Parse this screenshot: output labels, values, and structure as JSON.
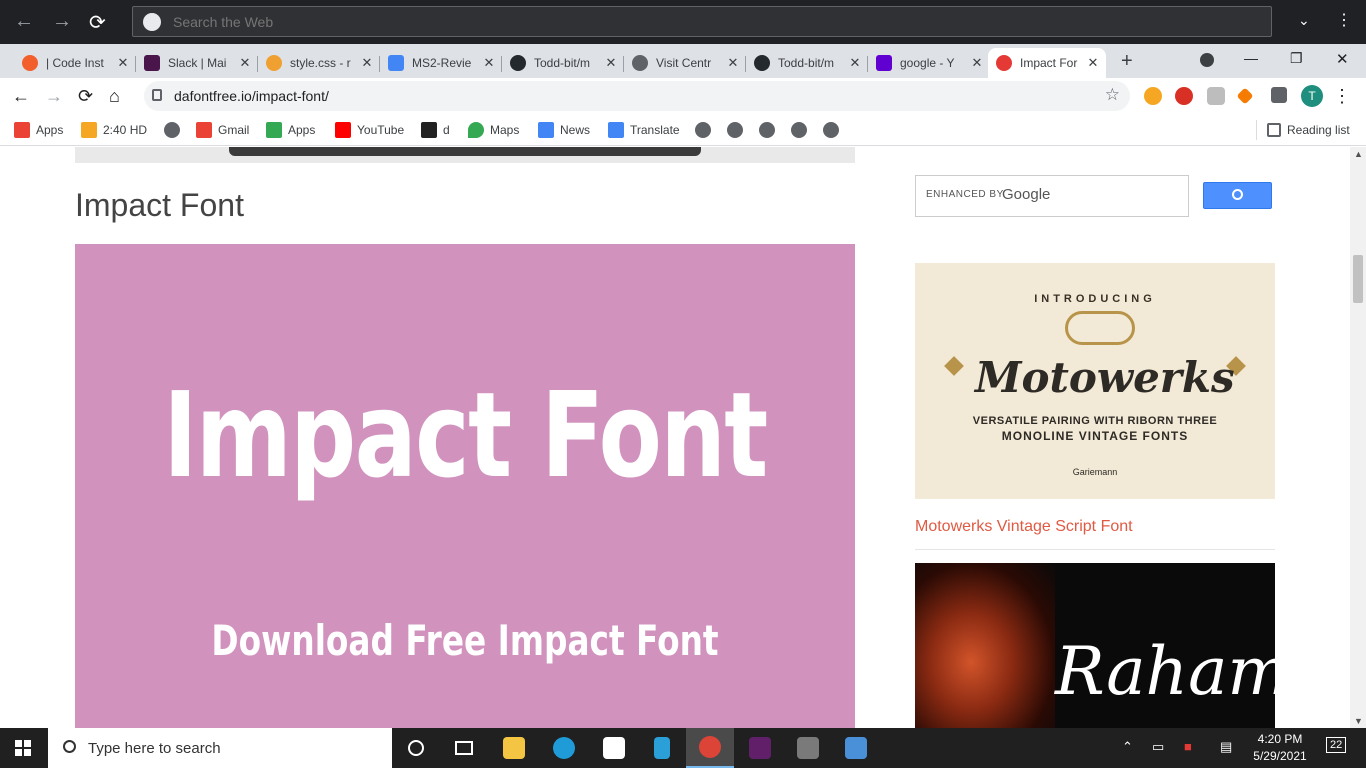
{
  "top_search": {
    "placeholder": "Search the Web"
  },
  "tabs": [
    {
      "label": "| Code Inst",
      "color": "#f25f2c"
    },
    {
      "label": "Slack | Mai",
      "color": "#4a154b"
    },
    {
      "label": "style.css - r",
      "color": "#f0a030"
    },
    {
      "label": "MS2-Revie",
      "color": "#4285f4"
    },
    {
      "label": "Todd-bit/m",
      "color": "#24292e"
    },
    {
      "label": "Visit Centr",
      "color": "#5f6368"
    },
    {
      "label": "Todd-bit/m",
      "color": "#24292e"
    },
    {
      "label": "google - Y",
      "color": "#6001d2"
    },
    {
      "label": "Impact For",
      "color": "#e53935"
    }
  ],
  "new_tab": "+",
  "window_controls": {
    "minimize": "—",
    "restore": "❐",
    "close": "✕"
  },
  "omnibox": {
    "url": "dafontfree.io/impact-font/"
  },
  "profile_initial": "T",
  "bookmarks": [
    {
      "label": "Apps",
      "color": "#ea4335"
    },
    {
      "label": "2:40 HD",
      "color": "#f5a623"
    },
    {
      "label": "",
      "color": "#5f6368"
    },
    {
      "label": "Gmail",
      "color": "#ea4335"
    },
    {
      "label": "Apps",
      "color": "#34a853"
    },
    {
      "label": "YouTube",
      "color": "#ff0000"
    },
    {
      "label": "d",
      "color": "#222222"
    },
    {
      "label": "Maps",
      "color": "#34a853"
    },
    {
      "label": "News",
      "color": "#4285f4"
    },
    {
      "label": "Translate",
      "color": "#4285f4"
    },
    {
      "label": "",
      "color": "#5f6368"
    },
    {
      "label": "",
      "color": "#5f6368"
    },
    {
      "label": "",
      "color": "#5f6368"
    },
    {
      "label": "",
      "color": "#5f6368"
    },
    {
      "label": "",
      "color": "#5f6368"
    }
  ],
  "reading_list": "Reading list",
  "page": {
    "title": "Impact Font",
    "banner_title": "Impact Font",
    "banner_subtitle": "Download Free Impact Font",
    "banner_color": "#d192bd"
  },
  "sidebar": {
    "search_label": "ENHANCED BY",
    "search_brand": "Google",
    "ad1": {
      "intro": "INTRODUCING",
      "title": "Motowerks",
      "line1": "VERSATILE PAIRING WITH RIBORN THREE",
      "line2": "MONOLINE VINTAGE FONTS",
      "maker": "Gariemann"
    },
    "link1": "Motowerks Vintage Script Font",
    "ad2": {
      "title": "Rahamitta"
    }
  },
  "taskbar": {
    "search_placeholder": "Type here to search",
    "time": "4:20 PM",
    "date": "5/29/2021",
    "notifications": "22"
  }
}
